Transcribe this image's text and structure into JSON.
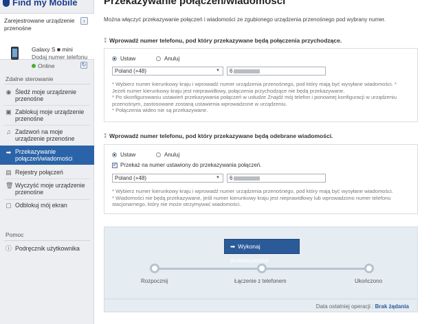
{
  "app": {
    "title": "Find my Mobile"
  },
  "sidebar": {
    "device_header": "Zarejestrowane urządzenie przenośne",
    "device_name": "Galaxy S ■ mini",
    "device_number": "Dodaj numer telefonu",
    "status": "Online",
    "remote_title": "Zdalne sterowanie",
    "items": [
      {
        "label": "Śledź moje urządzenie przenośne",
        "icon": "location-pin-icon"
      },
      {
        "label": "Zablokuj moje urządzenie przenośne",
        "icon": "lock-icon"
      },
      {
        "label": "Zadzwoń na moje urządzenie przenośne",
        "icon": "music-note-icon"
      },
      {
        "label": "Przekazywanie połączeń/wiadomości",
        "icon": "forward-arrow-icon"
      },
      {
        "label": "Rejestry połączeń",
        "icon": "document-icon"
      },
      {
        "label": "Wyczyść moje urządzenie przenośne",
        "icon": "trash-icon"
      },
      {
        "label": "Odblokuj mój ekran",
        "icon": "unlock-icon"
      }
    ],
    "help_title": "Pomoc",
    "help_item": "Podręcznik użytkownika"
  },
  "main": {
    "title": "Przekazywanie połączeń/wiadomości",
    "intro": "Można włączyć przekazywanie połączeń i wiadomości ze zgubionego urządzenia przenośnego pod wybrany numer.",
    "calls": {
      "heading": "Wprowadź numer telefonu, pod który przekazywane będą połączenia przychodzące.",
      "opt_set": "Ustaw",
      "opt_cancel": "Anuluj",
      "country": "Poland (+48)",
      "number_prefix": "6",
      "notes": [
        "* Wybierz numer kierunkowy kraju i wprowadź numer urządzenia przenośnego, pod który mają być wysyłane wiadomości. * Jeżeli numer kierunkowy kraju jest nieprawidłowy, połączenia przychodzące nie będą przekazywane.",
        "* Po skonfigurowaniu ustawień przekazywania połączeń w usłudze Znajdź mój telefon i ponownej konfiguracji w urządzeniu przenośnym, zastosowane zostaną ustawienia wprowadzone w urządzeniu.",
        "* Połączenia wideo nie są przekazywane."
      ]
    },
    "messages": {
      "heading": "Wprowadź numer telefonu, pod który przekazywane będą odebrane wiadomości.",
      "opt_set": "Ustaw",
      "opt_cancel": "Anuluj",
      "checkbox_label": "Przekaż na numer ustawiony do przekazywania połączeń.",
      "country": "Poland (+48)",
      "number_prefix": "6",
      "notes": [
        "* Wybierz numer kierunkowy kraju i wprowadź numer urządzenia przenośnego, pod który mają być wysyłane wiadomości.",
        "* Wiadomości nie będą przekazywane, jeśli numer kierunkowy kraju jest nieprawidłowy lub wprowadzono numer telefonu stacjonarnego, który nie może otrzymywać wiadomości."
      ]
    },
    "progress": {
      "button": "Wykonaj przekazywanie",
      "steps": [
        "Rozpocznij",
        "Łączenie z telefonem",
        "Ukończono"
      ],
      "last_op_label": "Data ostatniej operacji :",
      "last_op_value": "Brak żądania"
    }
  }
}
